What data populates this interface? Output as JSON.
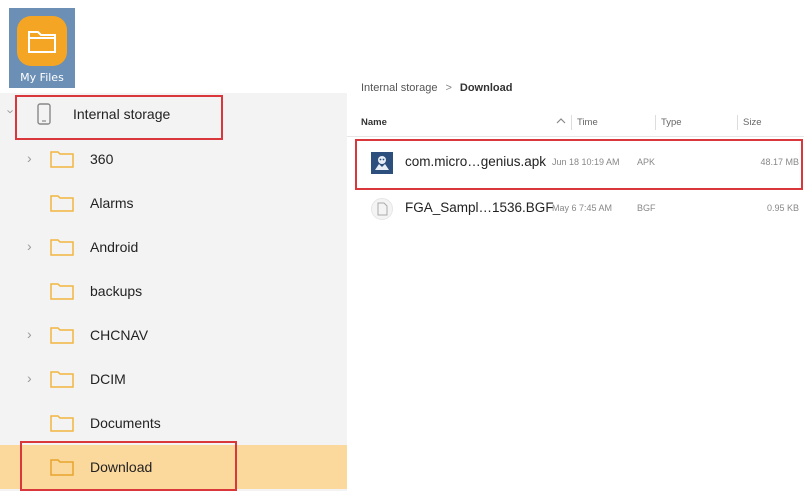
{
  "app_icon": {
    "label": "My Files",
    "icon": "folder-icon",
    "color": "#f4a523"
  },
  "sidebar": {
    "root": {
      "label": "Internal storage",
      "icon": "phone-icon"
    },
    "items": [
      {
        "label": "360",
        "expandable": true
      },
      {
        "label": "Alarms",
        "expandable": false
      },
      {
        "label": "Android",
        "expandable": true
      },
      {
        "label": "backups",
        "expandable": false
      },
      {
        "label": "CHCNAV",
        "expandable": true
      },
      {
        "label": "DCIM",
        "expandable": true
      },
      {
        "label": "Documents",
        "expandable": false
      },
      {
        "label": "Download",
        "expandable": false,
        "selected": true
      }
    ]
  },
  "breadcrumb": {
    "root": "Internal storage",
    "separator": ">",
    "current": "Download"
  },
  "list_header": {
    "name": "Name",
    "time": "Time",
    "type": "Type",
    "size": "Size"
  },
  "files": [
    {
      "name": "com.micro…genius.apk",
      "time": "Jun 18 10:19 AM",
      "type": "APK",
      "size": "48.17 MB",
      "icon": "apk-app-icon"
    },
    {
      "name": "FGA_Sampl…1536.BGF",
      "time": "May 6 7:45 AM",
      "type": "BGF",
      "size": "0.95 KB",
      "icon": "document-icon"
    }
  ],
  "colors": {
    "selected_bg": "#fbd89c",
    "highlight": "#d9373b",
    "folder": "#f2b640",
    "sidebar_bg": "#f3f3f3"
  }
}
